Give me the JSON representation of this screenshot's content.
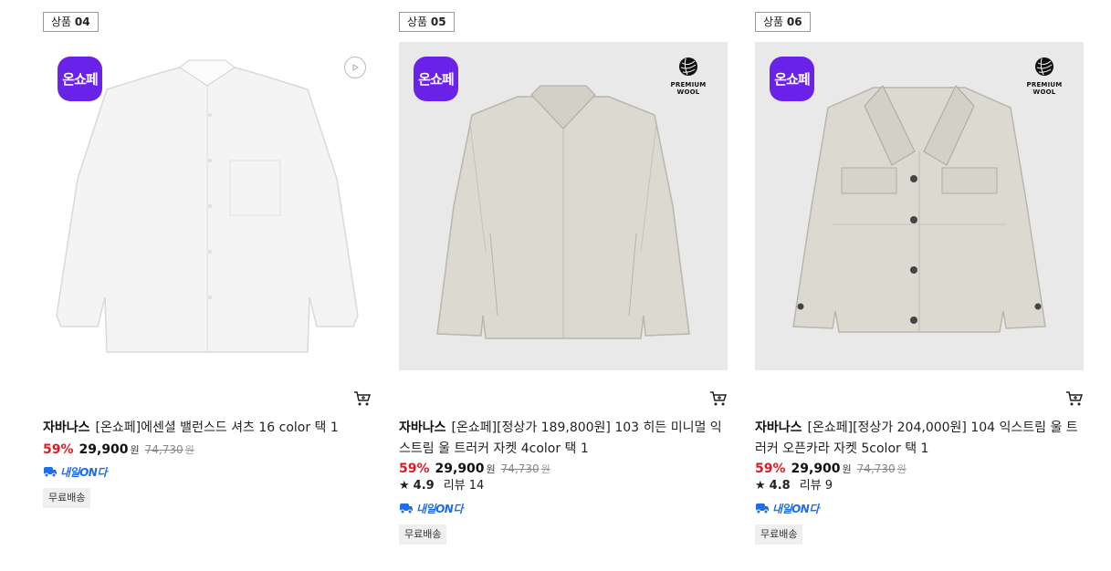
{
  "products": [
    {
      "badge_prefix": "상품",
      "badge_num": "04",
      "onshope_label": "온쇼페",
      "brand": "자바나스",
      "name": "[온쇼페]에센셜 밸런스드 셔츠 16 color 택 1",
      "discount": "59%",
      "sale_price": "29,900",
      "won": "원",
      "original_price": "74,730",
      "original_won": "원",
      "delivery_label": "내일ON다",
      "shipping_label": "무료배송"
    },
    {
      "badge_prefix": "상품",
      "badge_num": "05",
      "onshope_label": "온쇼페",
      "wool_label": "PREMIUM WOOL",
      "brand": "자바나스",
      "name": "[온쇼페][정상가 189,800원] 103 히든 미니멀 익스트림 울 트러커 자켓 4color 택 1",
      "discount": "59%",
      "sale_price": "29,900",
      "won": "원",
      "original_price": "74,730",
      "original_won": "원",
      "rating_score": "4.9",
      "review_label": "리뷰 14",
      "delivery_label": "내일ON다",
      "shipping_label": "무료배송"
    },
    {
      "badge_prefix": "상품",
      "badge_num": "06",
      "onshope_label": "온쇼페",
      "wool_label": "PREMIUM WOOL",
      "brand": "자바나스",
      "name": "[온쇼페][정상가 204,000원] 104 익스트림 울 트러커 오픈카라 자켓 5color 택 1",
      "discount": "59%",
      "sale_price": "29,900",
      "won": "원",
      "original_price": "74,730",
      "original_won": "원",
      "rating_score": "4.8",
      "review_label": "리뷰 9",
      "delivery_label": "내일ON다",
      "shipping_label": "무료배송"
    }
  ],
  "icons": {
    "cart": "cart-icon",
    "play": "play-icon",
    "star": "★",
    "wool": "wool-ball-icon",
    "delivery": "delivery-truck-icon"
  },
  "colors": {
    "onshope_purple": "#6a22e8",
    "discount_red": "#e01a22",
    "delivery_blue": "#1d6ee8"
  }
}
